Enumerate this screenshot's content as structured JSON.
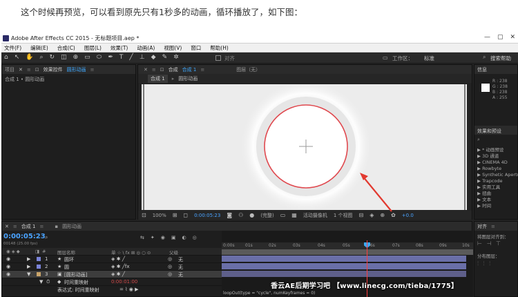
{
  "article": {
    "text": "这个时候再预览，可以看到原先只有1秒多的动画，循环播放了，如下图："
  },
  "window": {
    "title": "Adobe After Effects CC 2015 - 无标题项目.aep *",
    "min": "—",
    "max": "▢",
    "close": "✕"
  },
  "menu": [
    "文件(F)",
    "编辑(E)",
    "合成(C)",
    "图层(L)",
    "效果(T)",
    "动画(A)",
    "视图(V)",
    "窗口",
    "帮助(H)"
  ],
  "toolbar": {
    "align_label": "对齐",
    "workspace_label": "工作区：",
    "workspace_value": "标准",
    "search_label": "搜索帮助"
  },
  "left_panel": {
    "tab1": "项目",
    "tab2": "效果控件",
    "tab2_target": "圆形动画",
    "subtitle": "合成 1 • 圆形动画"
  },
  "comp_panel": {
    "tab_label": "合成",
    "tab_name": "合成 1",
    "layer_tab": "图层（无）",
    "crumb1": "合成 1",
    "crumb2": "圆形动画",
    "footer": {
      "zoom": "100%",
      "timecode": "0:00:05:23",
      "resolution": "(完整)",
      "camera": "活动摄像机",
      "views": "1 个视图",
      "exposure": "+0.0"
    }
  },
  "info_panel": {
    "title": "信息",
    "values": [
      "R : 238",
      "G : 238",
      "B : 238",
      "A : 255"
    ]
  },
  "effects_panel": {
    "title": "效果和预设",
    "items": [
      "▶ * 动画预设",
      "▶ 3D 通道",
      "▶ CINEMA 4D",
      "▶ Rowbyte",
      "▶ Synthetic Apertur",
      "▶ Trapcode",
      "▶ 实用工具",
      "▶ 扭曲",
      "▶ 文本",
      "▶ 时间"
    ]
  },
  "timeline": {
    "tab_comp": "合成 1",
    "tab_other": "圆形动画",
    "time": "0:00:05:23",
    "fps": "00148 (25.00 fps)",
    "header": {
      "name": "图层名称",
      "switches": "单 ☆ \\ fx ⊞ ◎ ○ ⊙",
      "parent": "父级"
    },
    "layers": [
      {
        "num": "1",
        "name": "圆环",
        "parent": "无",
        "color": "#7a83d8"
      },
      {
        "num": "2",
        "name": "圆",
        "parent": "无",
        "color": "#7a83d8"
      },
      {
        "num": "3",
        "name": "[圆形动画]",
        "parent": "无",
        "color": "#c9a46a"
      }
    ],
    "sub_row": "时间重映射",
    "sub_value": "0:00:01:00",
    "expr_row": "表达式: 时间重映射",
    "expression": "loopOut(type = \"cycle\", numKeyframes = 0)",
    "ruler": [
      "0:00s",
      "01s",
      "02s",
      "03s",
      "04s",
      "05s",
      "06s",
      "07s",
      "08s",
      "09s",
      "10s"
    ]
  },
  "align_panel": {
    "title": "对齐",
    "align_label": "将图层对齐到：",
    "distribute_label": "分布图层："
  },
  "watermark": "香云AE后期学习吧  【www.linecg.com/tieba/1775】"
}
